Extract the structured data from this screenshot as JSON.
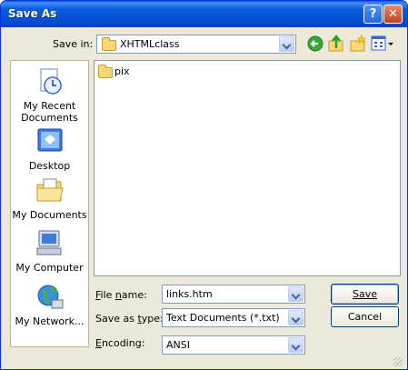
{
  "window": {
    "title": "Save As",
    "help_glyph": "?",
    "close_glyph": "✕"
  },
  "toolbar": {
    "save_in_label": "Save in:",
    "save_in_value": "XHTMLclass",
    "back_icon": "back-arrow-icon",
    "up_icon": "up-folder-icon",
    "new_folder_icon": "new-folder-icon",
    "views_icon": "views-menu-icon"
  },
  "places": [
    {
      "label": "My Recent Documents",
      "icon": "recent-documents-icon"
    },
    {
      "label": "Desktop",
      "icon": "desktop-icon"
    },
    {
      "label": "My Documents",
      "icon": "my-documents-icon"
    },
    {
      "label": "My Computer",
      "icon": "my-computer-icon"
    },
    {
      "label": "My Network...",
      "icon": "my-network-icon"
    }
  ],
  "files": [
    {
      "name": "pix",
      "type": "folder"
    }
  ],
  "form": {
    "file_name_label": "File name:",
    "file_name_value": "links.htm",
    "save_type_label": "Save as type:",
    "save_type_value": "Text Documents (*.txt)",
    "encoding_label": "Encoding:",
    "encoding_value": "ANSI"
  },
  "buttons": {
    "save": "Save",
    "cancel": "Cancel"
  },
  "colors": {
    "title_bar": "#0a5fe0",
    "dialog_bg": "#ece9d8",
    "close_button": "#c2401c"
  }
}
